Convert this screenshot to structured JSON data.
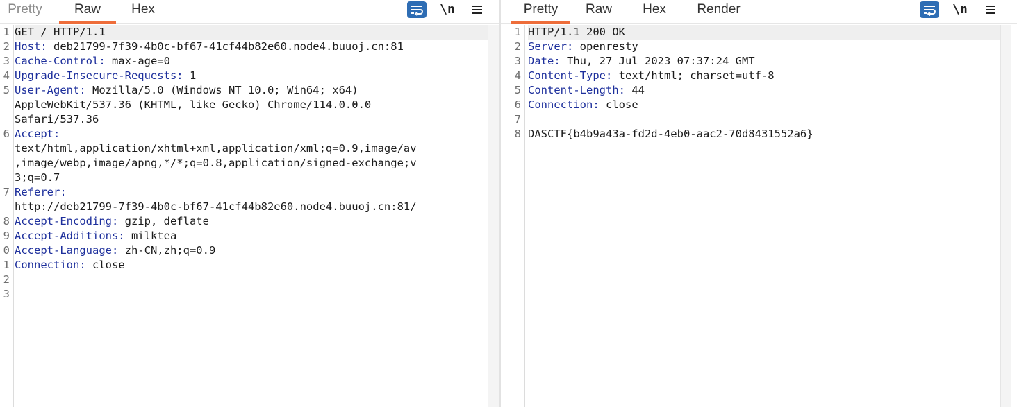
{
  "request": {
    "tabs": [
      {
        "label": "Pretty",
        "active": false
      },
      {
        "label": "Raw",
        "active": true
      },
      {
        "label": "Hex",
        "active": false
      }
    ],
    "newline_label": "\\n",
    "lines": [
      {
        "n": "1",
        "name": "",
        "value": "GET / HTTP/1.1"
      },
      {
        "n": "2",
        "name": "Host:",
        "value": " deb21799-7f39-4b0c-bf67-41cf44b82e60.node4.buuoj.cn:81"
      },
      {
        "n": "3",
        "name": "Cache-Control:",
        "value": " max-age=0"
      },
      {
        "n": "4",
        "name": "Upgrade-Insecure-Requests:",
        "value": " 1"
      },
      {
        "n": "5",
        "name": "User-Agent:",
        "value": " Mozilla/5.0 (Windows NT 10.0; Win64; x64)"
      },
      {
        "n": "",
        "name": "",
        "value": "AppleWebKit/537.36 (KHTML, like Gecko) Chrome/114.0.0.0"
      },
      {
        "n": "",
        "name": "",
        "value": "Safari/537.36"
      },
      {
        "n": "6",
        "name": "Accept:",
        "value": ""
      },
      {
        "n": "",
        "name": "",
        "value": "text/html,application/xhtml+xml,application/xml;q=0.9,image/av"
      },
      {
        "n": "",
        "name": "",
        "value": ",image/webp,image/apng,*/*;q=0.8,application/signed-exchange;v"
      },
      {
        "n": "",
        "name": "",
        "value": "3;q=0.7"
      },
      {
        "n": "7",
        "name": "Referer:",
        "value": ""
      },
      {
        "n": "",
        "name": "",
        "value": "http://deb21799-7f39-4b0c-bf67-41cf44b82e60.node4.buuoj.cn:81/"
      },
      {
        "n": "8",
        "name": "Accept-Encoding:",
        "value": " gzip, deflate"
      },
      {
        "n": "9",
        "name": "Accept-Additions:",
        "value": " milktea"
      },
      {
        "n": "0",
        "name": "Accept-Language:",
        "value": " zh-CN,zh;q=0.9"
      },
      {
        "n": "1",
        "name": "Connection:",
        "value": " close"
      },
      {
        "n": "2",
        "name": "",
        "value": ""
      },
      {
        "n": "3",
        "name": "",
        "value": ""
      }
    ]
  },
  "response": {
    "tabs": [
      {
        "label": "Pretty",
        "active": true
      },
      {
        "label": "Raw",
        "active": false
      },
      {
        "label": "Hex",
        "active": false
      },
      {
        "label": "Render",
        "active": false
      }
    ],
    "newline_label": "\\n",
    "lines": [
      {
        "n": "1",
        "name": "",
        "value": "HTTP/1.1 200 OK"
      },
      {
        "n": "2",
        "name": "Server:",
        "value": " openresty"
      },
      {
        "n": "3",
        "name": "Date:",
        "value": " Thu, 27 Jul 2023 07:37:24 GMT"
      },
      {
        "n": "4",
        "name": "Content-Type:",
        "value": " text/html; charset=utf-8"
      },
      {
        "n": "5",
        "name": "Content-Length:",
        "value": " 44"
      },
      {
        "n": "6",
        "name": "Connection:",
        "value": " close"
      },
      {
        "n": "7",
        "name": "",
        "value": ""
      },
      {
        "n": "8",
        "name": "",
        "value": "DASCTF{b4b9a43a-fd2d-4eb0-aac2-70d8431552a6}"
      }
    ]
  },
  "colors": {
    "accent_tab_underline": "#ee6d3a",
    "wrap_button": "#2e6db4",
    "header_name": "#1d2f9c"
  },
  "icons": {
    "wrap": "wrap-lines-icon",
    "menu": "hamburger-menu-icon"
  }
}
